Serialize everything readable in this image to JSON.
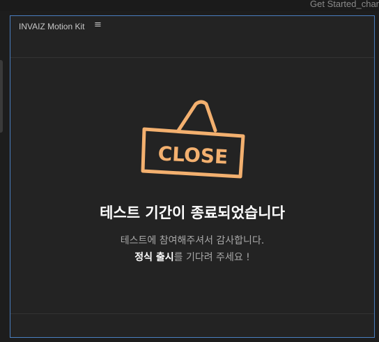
{
  "window": {
    "title": "Get Started_char"
  },
  "panel": {
    "title": "INVAIZ Motion Kit",
    "menu_icon": "hamburger-menu-icon"
  },
  "notice": {
    "sign_text": "CLOSE",
    "sign_color": "#f3b06f",
    "heading": "테스트 기간이 종료되었습니다",
    "line1": "테스트에 참여해주셔서 감사합니다.",
    "line2_bold": "정식 출시",
    "line2_rest": "를 기다려 주세요 !"
  }
}
